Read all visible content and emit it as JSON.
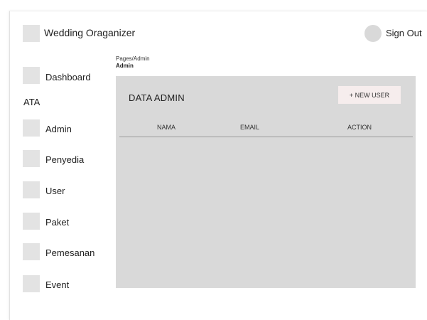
{
  "header": {
    "brand": "Wedding Oraganizer",
    "sign_out": "Sign Out"
  },
  "sidebar": {
    "stray_text": "ATA",
    "items": [
      {
        "label": "Dashboard"
      },
      {
        "label": "Admin"
      },
      {
        "label": "Penyedia"
      },
      {
        "label": "User"
      },
      {
        "label": "Paket"
      },
      {
        "label": "Pemesanan"
      },
      {
        "label": "Event"
      }
    ]
  },
  "breadcrumb": {
    "path": "Pages/Admin",
    "current": "Admin"
  },
  "panel": {
    "title": "DATA ADMIN",
    "new_button": "+ NEW USER",
    "columns": [
      "NAMA",
      "EMAIL",
      "ACTION"
    ],
    "rows": []
  },
  "colors": {
    "placeholder": "#e3e3e3",
    "panel_bg": "#d9d9d9",
    "button_bg": "#f6eded"
  },
  "icons": {
    "logo": "logo-placeholder-icon",
    "avatar": "user-avatar-icon",
    "sidebar": "nav-placeholder-icon"
  }
}
